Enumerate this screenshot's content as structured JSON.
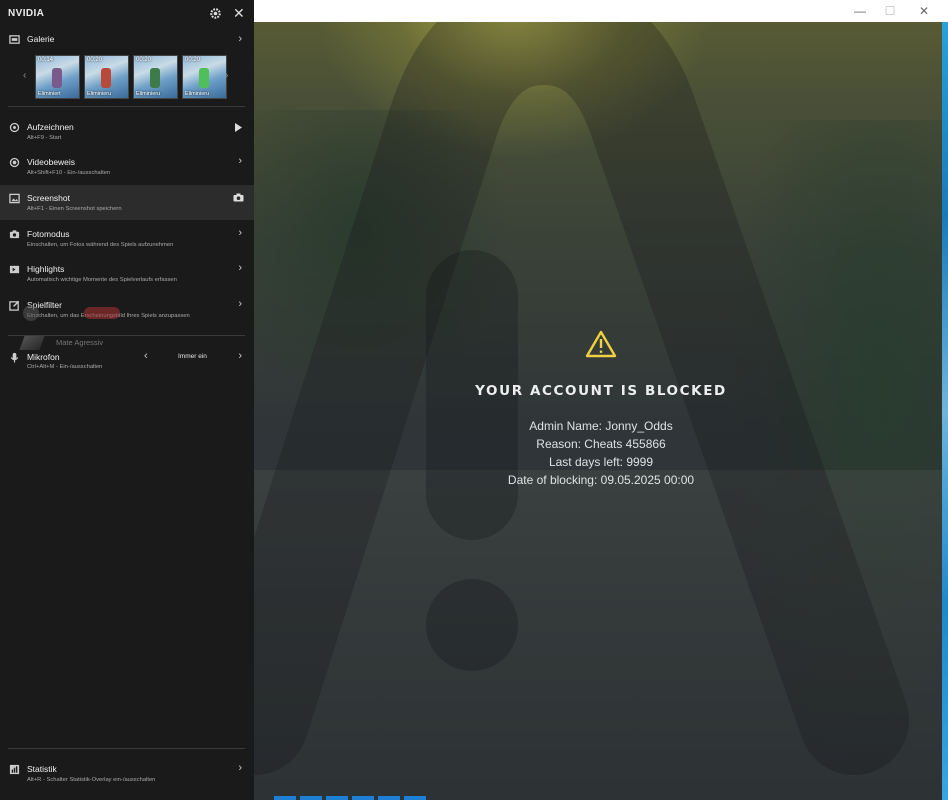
{
  "overlay": {
    "brand": "NVIDIA",
    "gallery": {
      "title": "Galerie",
      "thumbs": [
        {
          "duration": "00:14",
          "label": "Eliminiert"
        },
        {
          "duration": "00:20",
          "label": "Eliminieru"
        },
        {
          "duration": "00:20",
          "label": "Eliminieru"
        },
        {
          "duration": "00:20",
          "label": "Eliminieru"
        }
      ]
    },
    "items": [
      {
        "title": "Aufzeichnen",
        "subtitle": "Alt+F9 - Start"
      },
      {
        "title": "Videobeweis",
        "subtitle": "Alt+Shift+F10 - Ein-/ausschalten"
      },
      {
        "title": "Screenshot",
        "subtitle": "Alt+F1 - Einen Screenshot speichern"
      },
      {
        "title": "Fotomodus",
        "subtitle": "Einschalten, um Fotos während des Spiels aufzunehmen"
      },
      {
        "title": "Highlights",
        "subtitle": "Automatisch wichtige Momente des Spielverlaufs erfassen"
      },
      {
        "title": "Spielfilter",
        "subtitle": "Einschalten, um das Erscheinungsbild Ihres Spiels anzupassen"
      }
    ],
    "ghost_text": "Mate Agressiv",
    "mic": {
      "title": "Mikrofon",
      "subtitle": "Ctrl+Alt+M - Ein-/ausschalten",
      "value": "Immer ein"
    },
    "stats": {
      "title": "Statistik",
      "subtitle": "Alt+R - Schalter Statistik-Overlay ein-/ausschalten"
    }
  },
  "game": {
    "blocked_title": "YOUR ACCOUNT IS BLOCKED",
    "lines": [
      "Admin Name: Jonny_Odds",
      "Reason: Cheats 455866",
      "Last days left: 9999",
      "Date of blocking: 09.05.2025 00:00"
    ],
    "window_controls": {
      "minimize": "—",
      "maximize": "☐",
      "close": "✕"
    }
  },
  "colors": {
    "panel_bg": "#1a1a1a",
    "warning": "#f0d040",
    "text": "#eceef0",
    "taskbar_accent": "#1e7fd6"
  }
}
